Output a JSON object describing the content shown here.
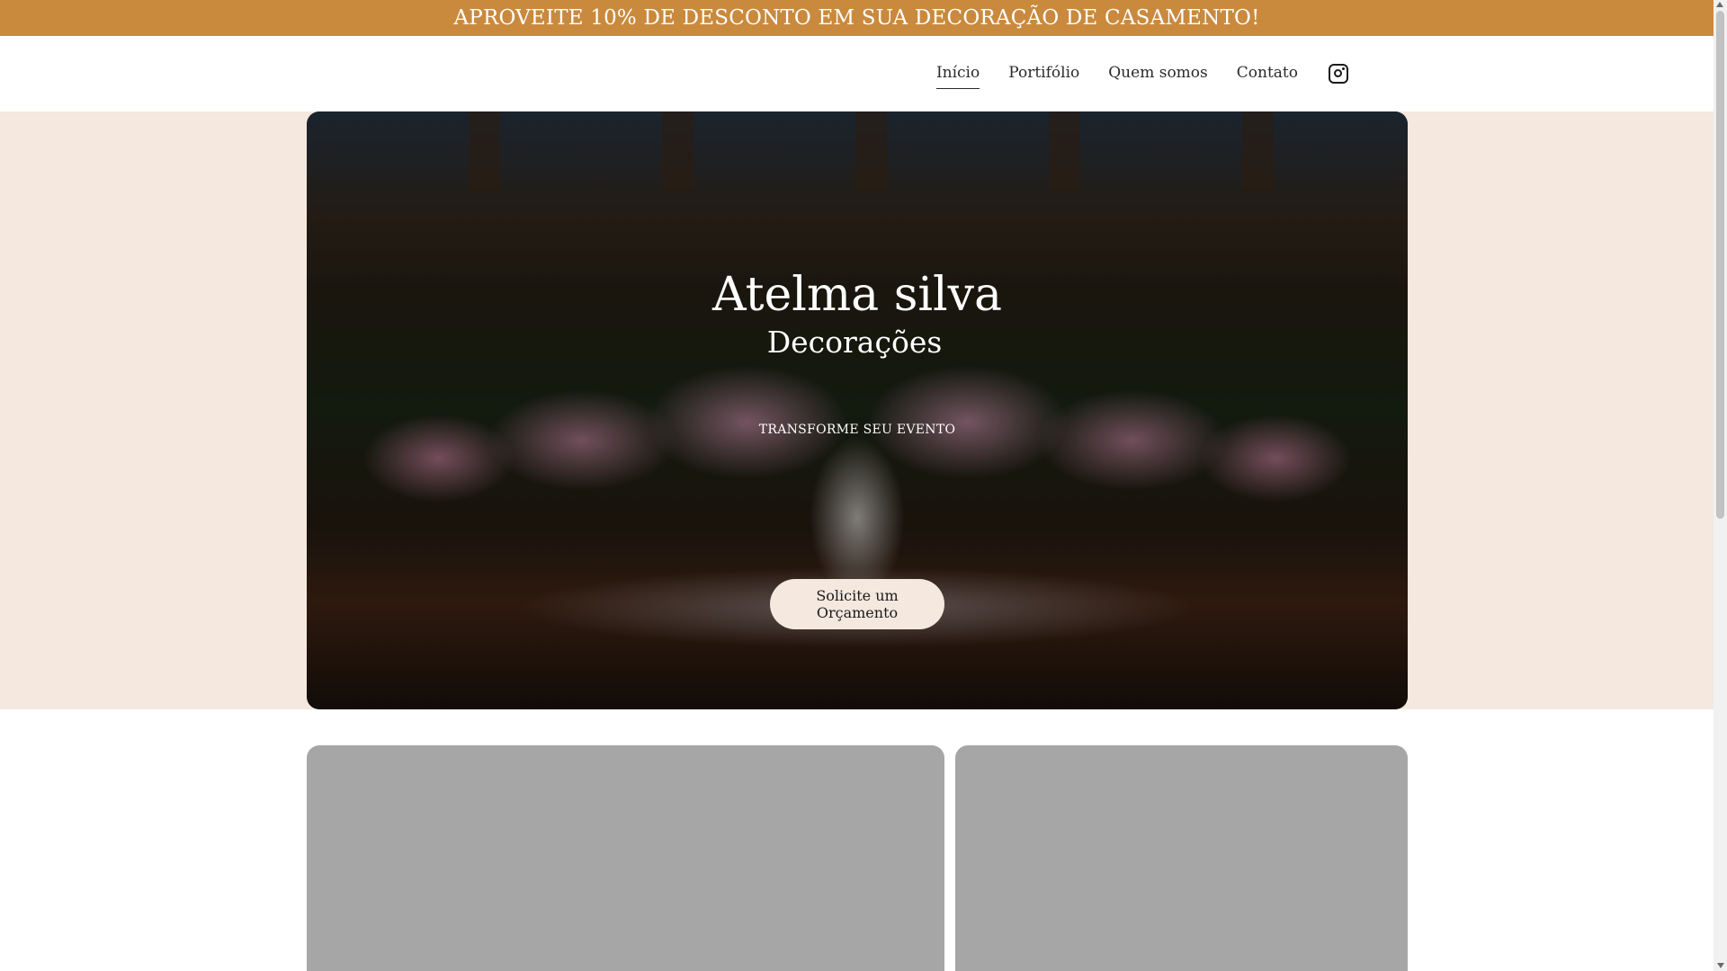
{
  "promo": {
    "text": "APROVEITE 10% DE DESCONTO EM SUA DECORAÇÃO DE CASAMENTO!"
  },
  "nav": {
    "items": [
      {
        "label": "Início",
        "active": true
      },
      {
        "label": "Portifólio"
      },
      {
        "label": "Quem somos"
      },
      {
        "label": "Contato"
      }
    ],
    "social_icon": "instagram-icon"
  },
  "hero": {
    "title": "Atelma silva",
    "subtitle": "Decorações",
    "tagline": "TRANSFORME SEU EVENTO",
    "cta_label": "Solicite um Orçamento"
  },
  "colors": {
    "promo_bg": "#c98a3e",
    "hero_band_bg": "#f4e8df",
    "cta_bg": "#f4e8df",
    "card_placeholder": "#a6a6a6"
  }
}
